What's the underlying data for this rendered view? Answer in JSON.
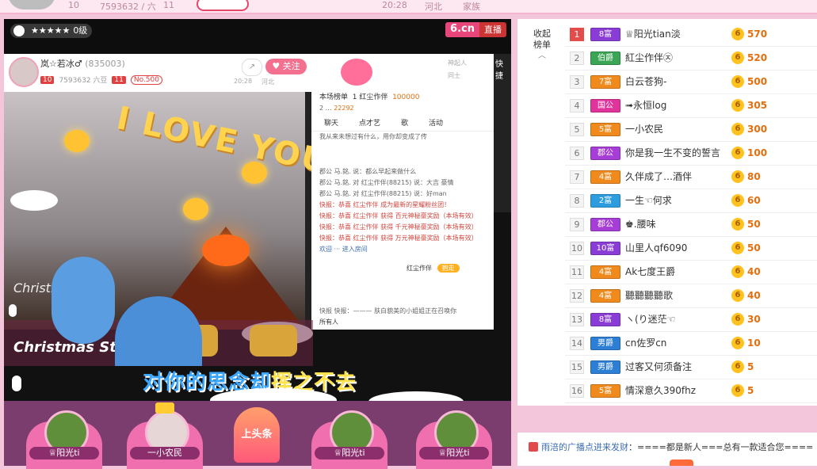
{
  "top": {
    "level_frag": "10",
    "count_frag": "7593632 / 六",
    "level2_frag": "11",
    "time_frag": "20:28",
    "place_frag": "河北",
    "family_frag": "家族"
  },
  "stream": {
    "level_label": "0级",
    "logo": "6.cn",
    "logo_tag": "直播",
    "anchor": {
      "name": "岚☆若冰♂",
      "room_id": "(835003)",
      "level": "10",
      "fans": "7593632 六豆",
      "level2": "11",
      "no": "No.500",
      "time": "20:28",
      "place": "河北",
      "follow": "关注",
      "side1": "神起人",
      "side2": "同士"
    },
    "quick": "快捷",
    "love_text": "I LOVE YOU",
    "inner_chat": {
      "header_label": "本场榜单",
      "top1_name": "红尘作伴",
      "top1_score": "100000",
      "top2_score": "22292",
      "tabs": [
        "聊天",
        "点才艺",
        "歌",
        "活动"
      ],
      "lines": [
        "我从来未想过有什么，用你却变成了传",
        "郡公 马.銘. 说：都么早起来做什么",
        "郡公 马.銘. 对 红尘作伴(88215) 说：大吉 豪情",
        "郡公 马.銘. 对 红尘作伴(88215) 说：好man",
        "快报：恭喜 红尘作伴 成为最新的星耀粉丝团！",
        "快报：恭喜 红尘作伴 获得 百元神秘豪奖励（本场有效）",
        "快报：恭喜 红尘作伴 获得 千元神秘豪奖励（本场有效）",
        "快报：恭喜 红尘作伴 获得 万元神秘豪奖励（本场有效）",
        "欢迎 ··· 进入房间",
        "快报 快报：——— 肤白貌美的小姐姐正在召唤你"
      ],
      "gift_name": "红尘作伴",
      "gift_btn": "抱走",
      "chat_hint": "所有人"
    },
    "xmas_1": "Christmas",
    "xmas_2": "Christmas Star",
    "lyric": "对你的思念却",
    "lyric_end": "挥之不去"
  },
  "seats": [
    {
      "label": "♕阳光ti"
    },
    {
      "label": "一小农民"
    },
    {
      "label": "♕阳光ti"
    },
    {
      "label": "♕阳光ti"
    }
  ],
  "headline": "上头条",
  "board": {
    "collapse_label": "收起榜单",
    "rows": [
      {
        "rank": "1",
        "badge": "8富",
        "badge_color": "#8a3dd6",
        "name": "♕阳光tian淡",
        "score": "570"
      },
      {
        "rank": "2",
        "badge": "伯爵",
        "badge_color": "#3aa655",
        "name": "紅尘作伴㉨",
        "score": "520"
      },
      {
        "rank": "3",
        "badge": "7富",
        "badge_color": "#f08a1c",
        "name": "白云苍狗-",
        "score": "500"
      },
      {
        "rank": "4",
        "badge": "国公",
        "badge_color": "#e0339b",
        "name": "➟永恒log",
        "score": "305"
      },
      {
        "rank": "5",
        "badge": "5富",
        "badge_color": "#f08a1c",
        "name": "一小农民",
        "score": "300"
      },
      {
        "rank": "6",
        "badge": "郡公",
        "badge_color": "#a63dd6",
        "name": "你是我一生不变的誓言",
        "score": "100"
      },
      {
        "rank": "7",
        "badge": "4富",
        "badge_color": "#f08a1c",
        "name": "久伴成了…酒伴",
        "score": "80"
      },
      {
        "rank": "8",
        "badge": "2富",
        "badge_color": "#2d9de0",
        "name": "一生☜何求",
        "score": "60"
      },
      {
        "rank": "9",
        "badge": "郡公",
        "badge_color": "#a63dd6",
        "name": "♚.腰味",
        "score": "50"
      },
      {
        "rank": "10",
        "badge": "10富",
        "badge_color": "#8a3dd6",
        "name": "山里人qf6090",
        "score": "50"
      },
      {
        "rank": "11",
        "badge": "4富",
        "badge_color": "#f08a1c",
        "name": "Ak七度王爵",
        "score": "40"
      },
      {
        "rank": "12",
        "badge": "4富",
        "badge_color": "#f08a1c",
        "name": "聽聽聽聽歌",
        "score": "40"
      },
      {
        "rank": "13",
        "badge": "8富",
        "badge_color": "#8a3dd6",
        "name": "ヽ(り迷茫☜",
        "score": "30"
      },
      {
        "rank": "14",
        "badge": "男爵",
        "badge_color": "#2d7fd6",
        "name": "cn佐罗cn",
        "score": "10"
      },
      {
        "rank": "15",
        "badge": "男爵",
        "badge_color": "#2d7fd6",
        "name": "过客又何须备注",
        "score": "5"
      },
      {
        "rank": "16",
        "badge": "5富",
        "badge_color": "#f08a1c",
        "name": "情深意久390fhz",
        "score": "5"
      }
    ]
  },
  "broadcast": {
    "user": "雨涪的广播点进来发财",
    "message": "：====都是新人===总有一款适合您===="
  },
  "colors": {
    "accent": "#f4708f",
    "score": "#e06f10",
    "rank1": "#e44b4b"
  }
}
